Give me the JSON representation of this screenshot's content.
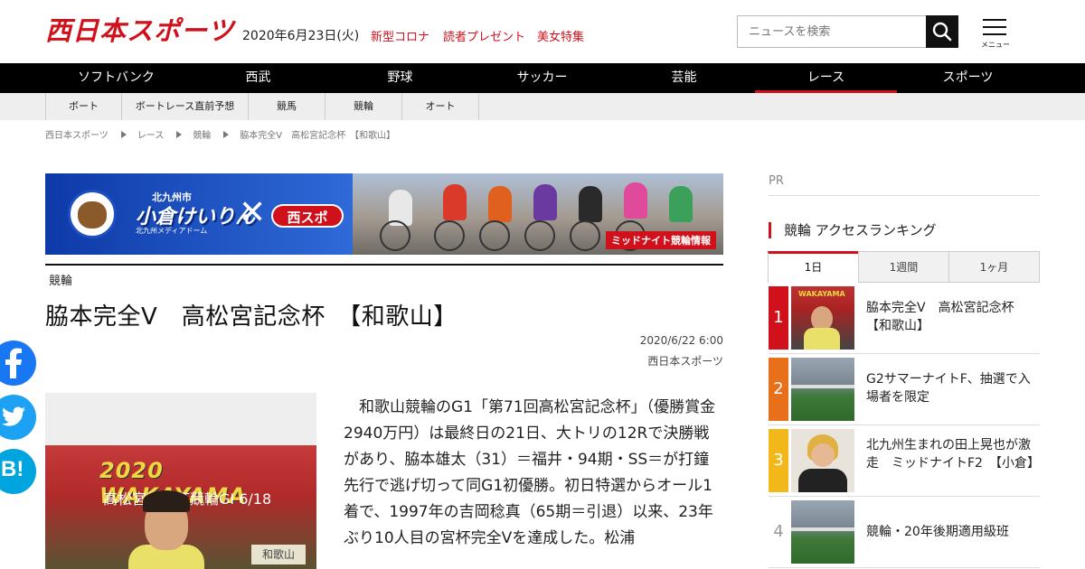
{
  "header": {
    "logo": "西日本スポーツ",
    "date": "2020年6月23日(火)",
    "links": [
      "新型コロナ",
      "読者プレゼント",
      "美女特集"
    ],
    "search_placeholder": "ニュースを検索",
    "menu_label": "メニュー"
  },
  "mainnav": {
    "items": [
      "ソフトバンク",
      "西武",
      "野球",
      "サッカー",
      "芸能",
      "レース",
      "スポーツ"
    ],
    "active": "レース"
  },
  "subnav": {
    "items": [
      "ボート",
      "ボートレース直前予想",
      "競馬",
      "競輪",
      "オート"
    ]
  },
  "breadcrumb": [
    "西日本スポーツ",
    "レース",
    "競輪",
    "脇本完全V　高松宮記念杯　【和歌山】"
  ],
  "banner": {
    "title": "小倉けいりん",
    "top_text": "北九州市",
    "sub": "北九州メディアドーム",
    "x": "✕",
    "brand": "西スポ",
    "caption": "ミッドナイト競輪情報"
  },
  "article": {
    "category": "競輪",
    "title": "脇本完全V　高松宮記念杯　【和歌山】",
    "date": "2020/6/22 6:00",
    "source": "西日本スポーツ",
    "photo": {
      "banner": "2020 WAKAYAMA",
      "sub": "高松宮記念杯競輪GI 6/18",
      "tag": "和歌山"
    },
    "body": "　和歌山競輪のG1「第71回高松宮記念杯」（優勝賞金2940万円）は最終日の21日、大トリの12Rで決勝戦があり、脇本雄太（31）＝福井・94期・SS＝が打鐘先行で逃げ切って同G1初優勝。初日特選からオール1着で、1997年の吉岡稔真（65期＝引退）以来、23年ぶり10人目の宮杯完全Vを達成した。松浦"
  },
  "sidebar": {
    "pr": "PR",
    "ranking_title": "競輪 アクセスランキング",
    "tabs": [
      "1日",
      "1週間",
      "1ヶ月"
    ],
    "active_tab": "1日",
    "items": [
      {
        "rank": "1",
        "title": "脇本完全V　高松宮記念杯　【和歌山】",
        "color": "#d0111b"
      },
      {
        "rank": "2",
        "title": "G2サマーナイトF、抽選で入場者を限定",
        "color": "#e8701a"
      },
      {
        "rank": "3",
        "title": "北九州生まれの田上晃也が激走　ミッドナイトF2　【小倉】",
        "color": "#f2b81a"
      },
      {
        "rank": "4",
        "title": "競輪・20年後期適用級班",
        "color": "#ffffff"
      }
    ]
  },
  "colors": {
    "brand_red": "#d0111b",
    "facebook": "#1877f2",
    "twitter": "#1da1f2",
    "hatena": "#00a4de"
  }
}
